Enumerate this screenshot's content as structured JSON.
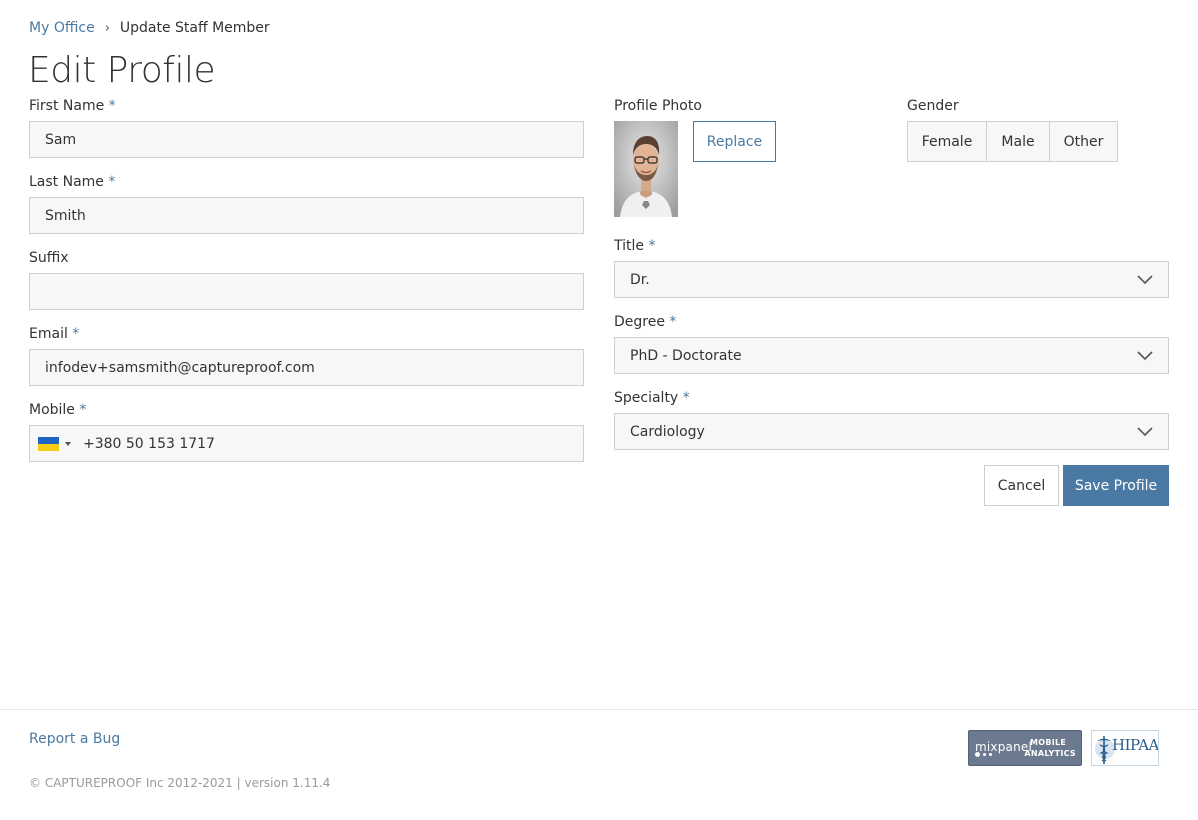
{
  "breadcrumb": {
    "root": "My Office",
    "separator": "›",
    "current": "Update Staff Member"
  },
  "page": {
    "title": "Edit Profile"
  },
  "form": {
    "first_name": {
      "label": "First Name",
      "required_mark": "*",
      "value": "Sam"
    },
    "last_name": {
      "label": "Last Name",
      "required_mark": "*",
      "value": "Smith"
    },
    "suffix": {
      "label": "Suffix",
      "value": ""
    },
    "email": {
      "label": "Email",
      "required_mark": "*",
      "value": "infodev+samsmith@captureproof.com"
    },
    "mobile": {
      "label": "Mobile",
      "required_mark": "*",
      "country_flag": "ukraine-flag-icon",
      "value": "+380 50 153 1717"
    },
    "profile_photo": {
      "label": "Profile Photo",
      "replace_label": "Replace"
    },
    "gender": {
      "label": "Gender",
      "options": [
        "Female",
        "Male",
        "Other"
      ]
    },
    "title": {
      "label": "Title",
      "required_mark": "*",
      "value": "Dr."
    },
    "degree": {
      "label": "Degree",
      "required_mark": "*",
      "value": "PhD - Doctorate"
    },
    "specialty": {
      "label": "Specialty",
      "required_mark": "*",
      "value": "Cardiology"
    }
  },
  "actions": {
    "cancel_label": "Cancel",
    "save_label": "Save Profile"
  },
  "footer": {
    "report_bug": "Report a Bug",
    "copyright": "© CAPTUREPROOF Inc 2012-2021 | version 1.11.4",
    "mixpanel": {
      "name": "mixpanel",
      "line1": "MOBILE",
      "line2": "ANALYTICS"
    },
    "hipaa": {
      "text": "HIPAA"
    }
  },
  "colors": {
    "accent": "#4a7aa3",
    "input_bg": "#f7f7f7",
    "border": "#cfcfcf",
    "flag_blue": "#1f64c4",
    "flag_yellow": "#f6cd14"
  }
}
